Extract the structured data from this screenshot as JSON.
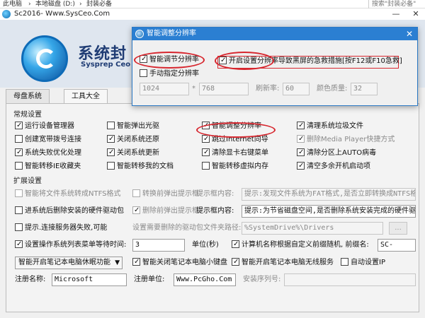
{
  "explorer": {
    "path_a": "此电脑",
    "path_b": "本地磁盘 (D:)",
    "path_c": "封装必备",
    "search_placeholder": "搜索\"封装必备\""
  },
  "app": {
    "title": "Sc2016- Www.SysCeo.Com",
    "minimize": "—",
    "close": "✕",
    "brand": "系统封",
    "brand_sub": "Sysprep Ceo",
    "tabs": [
      "母盘系统",
      "工具大全"
    ]
  },
  "common": {
    "title": "常规设置",
    "items": [
      {
        "label": "运行设备管理器",
        "checked": true,
        "disabled": false
      },
      {
        "label": "智能弹出光驱",
        "checked": false,
        "disabled": false
      },
      {
        "label": "智能调整分辨率",
        "checked": true,
        "disabled": false
      },
      {
        "label": "清理系统垃圾文件",
        "checked": true,
        "disabled": false
      },
      {
        "label": "创建宽带拨号连接",
        "checked": false,
        "disabled": false
      },
      {
        "label": "关闭系统还原",
        "checked": true,
        "disabled": false
      },
      {
        "label": "跳过Internet向导",
        "checked": true,
        "disabled": false
      },
      {
        "label": "删除Media Player快捷方式",
        "checked": true,
        "disabled": true
      },
      {
        "label": "系统失败优化处理",
        "checked": true,
        "disabled": false
      },
      {
        "label": "关闭系统更新",
        "checked": true,
        "disabled": false
      },
      {
        "label": "清除显卡右键菜单",
        "checked": true,
        "disabled": false
      },
      {
        "label": "清除分区上AUTO病毒",
        "checked": true,
        "disabled": false
      },
      {
        "label": "智能转移IE收藏夹",
        "checked": false,
        "disabled": false
      },
      {
        "label": "智能转移我的文档",
        "checked": false,
        "disabled": false
      },
      {
        "label": "智能转移虚拟内存",
        "checked": false,
        "disabled": false
      },
      {
        "label": "清空多余开机启动项",
        "checked": true,
        "disabled": false
      }
    ]
  },
  "extended": {
    "title": "扩展设置",
    "row1": {
      "ntfs_label": "智能将文件系统转成NTFS格式",
      "prompt_cb": "转换前弹出提示框",
      "prompt_label": "提示框内容:",
      "prompt_value": "提示:发现文件系统为FAT格式,是否立即转换成NTFS格式"
    },
    "row2": {
      "driver_label": "进系统后删除安装的硬件驱动包",
      "prompt_cb": "删除前弹出提示框",
      "prompt_label": "提示框内容:",
      "prompt_value": "提示:为节省磁盘空间,是否删除系统安装完成的硬件驱动包"
    },
    "row3": {
      "server_label": "提示.连接服务器失败,可能",
      "path_label": "设置需要删除的驱动包文件夹路径:",
      "path_value": "%SystemDrive%\\Drivers",
      "browse": "..."
    },
    "row4": {
      "menu_wait_label": "设置操作系统列表菜单等待时间:",
      "menu_wait_value": "3",
      "unit": "单位(秒)",
      "computer_name_label": "计算机名称根据自定义前缀随机, 前缀名:",
      "prefix_value": "SC-"
    },
    "row5": {
      "sleep_select": "智能开启笔记本电脑休眠功能",
      "keyboard_label": "智能关闭笔记本电脑小键盘",
      "wireless_label": "智能开启笔记本电脑无线服务",
      "auto_ip_label": "自动设置IP"
    },
    "row6": {
      "reg_name_label": "注册名称:",
      "reg_name_value": "Microsoft",
      "reg_unit_label": "注册单位:",
      "reg_unit_value": "Www.PcGho.Com",
      "serial_label": "安装序列号:"
    }
  },
  "dialog": {
    "title": "智能调整分辨率",
    "close": "✕",
    "smart_res_label": "智能调节分辨率",
    "black_screen_label": "开启设置分辨率导致黑屏的急救措施[按F12或F10急救]",
    "manual_label": "手动指定分辨率",
    "width_value": "1024",
    "times": "*",
    "height_value": "768",
    "refresh_label": "刷新率:",
    "refresh_value": "60",
    "color_label": "颜色质量:",
    "color_value": "32"
  }
}
